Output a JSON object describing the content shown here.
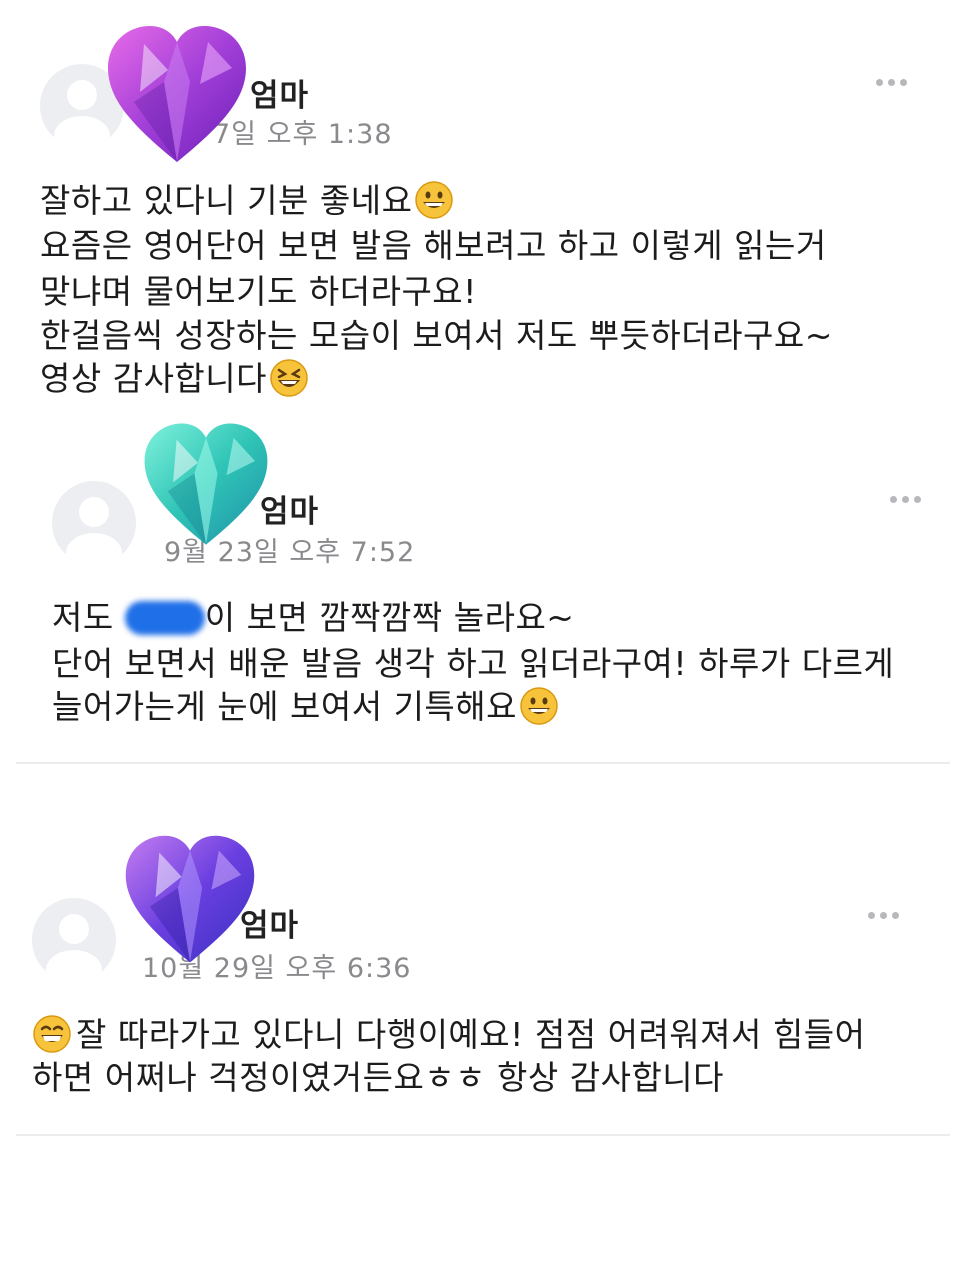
{
  "comments": [
    {
      "author": "엄마",
      "timestamp": "7일 오후 1:38",
      "lines": [
        "잘하고 있다니 기분 좋네요",
        "요즘은 영어단어 보면 발음 해보려고 하고 이렇게 읽는거",
        "맞냐며 물어보기도 하더라구요!",
        "한걸음씩 성장하는 모습이 보여서 저도 뿌듯하더라구요~",
        "영상 감사합니다"
      ],
      "sticker_color": "purple-pink",
      "more_icon": "more-dots-icon"
    },
    {
      "author": "엄마",
      "timestamp": "9월 23일 오후 7:52",
      "lines": [
        "저도",
        "이 보면 깜짝깜짝 놀라요~",
        "단어 보면서 배운 발음 생각 하고 읽더라구여! 하루가 다르게",
        "늘어가는게 눈에 보여서 기특해요"
      ],
      "sticker_color": "teal",
      "more_icon": "more-dots-icon"
    },
    {
      "author": "엄마",
      "timestamp": "10월 29일 오후 6:36",
      "lines": [
        "잘 따라가고 있다니 다행이예요! 점점 어려워져서 힘들어",
        "하면 어쩌나 걱정이였거든요ㅎㅎ 항상 감사합니다"
      ],
      "sticker_color": "indigo-purple",
      "more_icon": "more-dots-icon"
    }
  ],
  "colors": {
    "text": "#1c1c1e",
    "timestamp": "#8a8a8e",
    "divider": "#ececee",
    "redaction": "#1f6fe8"
  }
}
